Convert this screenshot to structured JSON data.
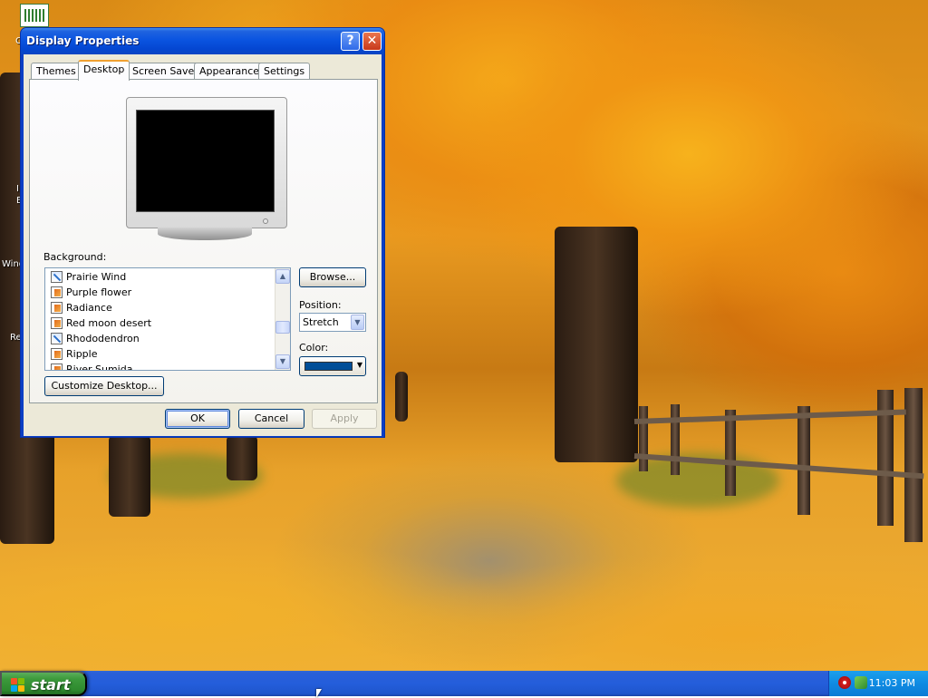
{
  "window": {
    "title": "Display Properties",
    "help_label": "?",
    "close_label": "✕"
  },
  "tabs": [
    {
      "label": "Themes",
      "active": false
    },
    {
      "label": "Desktop",
      "active": true
    },
    {
      "label": "Screen Saver",
      "active": false
    },
    {
      "label": "Appearance",
      "active": false
    },
    {
      "label": "Settings",
      "active": false
    }
  ],
  "background": {
    "label": "Background:",
    "items": [
      {
        "name": "Prairie Wind",
        "icon": "web-page-icon"
      },
      {
        "name": "Purple flower",
        "icon": "image-file-icon"
      },
      {
        "name": "Radiance",
        "icon": "image-file-icon"
      },
      {
        "name": "Red moon desert",
        "icon": "image-file-icon"
      },
      {
        "name": "Rhododendron",
        "icon": "web-page-icon"
      },
      {
        "name": "Ripple",
        "icon": "image-file-icon"
      },
      {
        "name": "River Sumida",
        "icon": "image-file-icon"
      }
    ],
    "scroll_up": "▲",
    "scroll_down": "▼"
  },
  "browse_label": "Browse...",
  "position": {
    "label": "Position:",
    "value": "Stretch",
    "arrow": "▼"
  },
  "color": {
    "label": "Color:",
    "value_hex": "#004e98",
    "arrow": "▼"
  },
  "customize_label": "Customize Desktop...",
  "buttons": {
    "ok": "OK",
    "cancel": "Cancel",
    "apply": "Apply"
  },
  "taskbar": {
    "start_label": "start",
    "clock": "11:03 PM"
  },
  "desktop_labels": [
    "C",
    "I",
    "E",
    "Wind",
    "Re"
  ],
  "colors": {
    "title_blue": "#0a54e0",
    "start_green": "#3c9a3c",
    "tab_accent": "#f0a030"
  }
}
